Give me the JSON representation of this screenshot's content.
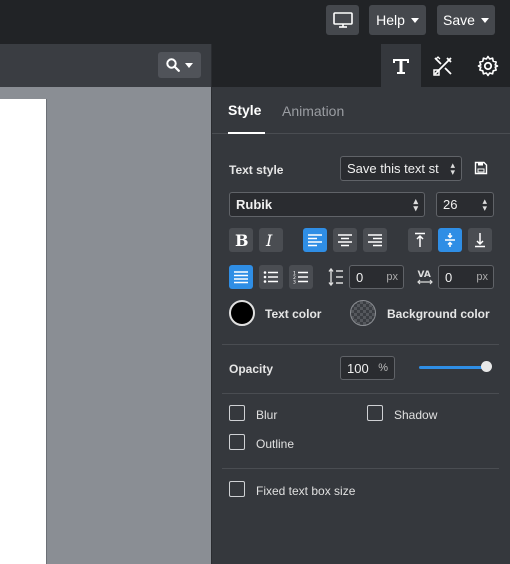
{
  "topbar": {
    "help_label": "Help",
    "save_label": "Save"
  },
  "panel": {
    "tabs": [
      "text-icon",
      "tools-icon",
      "gear-icon"
    ],
    "subtabs": {
      "style": "Style",
      "animation": "Animation"
    },
    "text_style": {
      "label": "Text style",
      "value": "Save this text st"
    },
    "font": {
      "family": "Rubik",
      "size": "26"
    },
    "line_spacing": {
      "value": "0",
      "unit": "px"
    },
    "letter_spacing": {
      "value": "0",
      "unit": "px"
    },
    "text_color_label": "Text color",
    "background_color_label": "Background color",
    "opacity": {
      "label": "Opacity",
      "value": "100",
      "unit": "%",
      "level": 1.0
    },
    "checks": {
      "blur": "Blur",
      "shadow": "Shadow",
      "outline": "Outline",
      "fixed_box": "Fixed text box size"
    }
  },
  "colors": {
    "accent": "#2f8ee5",
    "panel_bg": "#35383d",
    "topbar_bg": "#212326",
    "canvas_bg": "#8a8e94",
    "text_color": "#000000"
  }
}
